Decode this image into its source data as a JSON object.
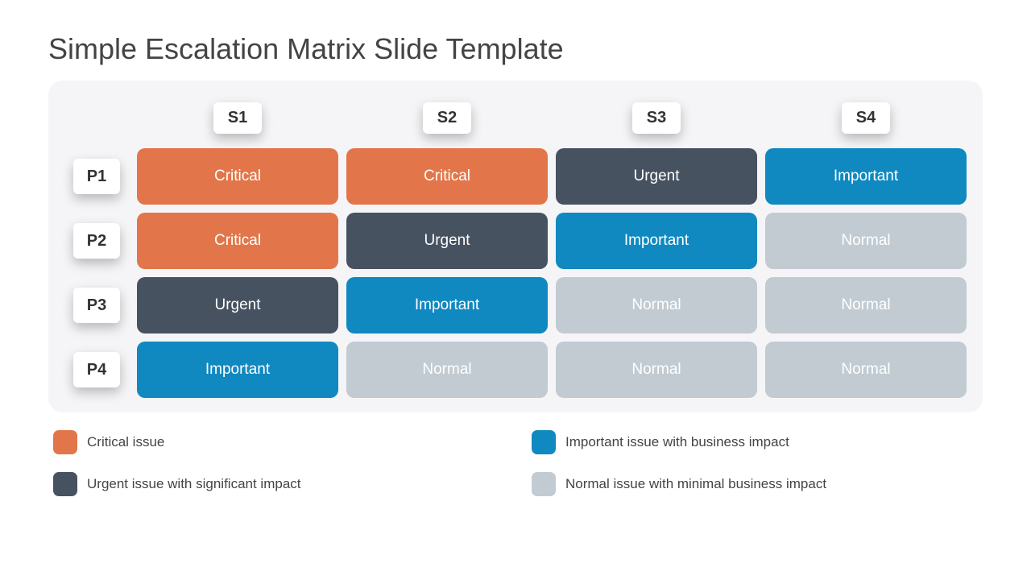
{
  "title": "Simple Escalation Matrix Slide Template",
  "columns": [
    "S1",
    "S2",
    "S3",
    "S4"
  ],
  "rows": [
    "P1",
    "P2",
    "P3",
    "P4"
  ],
  "cells": [
    [
      {
        "label": "Critical",
        "kind": "critical"
      },
      {
        "label": "Critical",
        "kind": "critical"
      },
      {
        "label": "Urgent",
        "kind": "urgent"
      },
      {
        "label": "Important",
        "kind": "important"
      }
    ],
    [
      {
        "label": "Critical",
        "kind": "critical"
      },
      {
        "label": "Urgent",
        "kind": "urgent"
      },
      {
        "label": "Important",
        "kind": "important"
      },
      {
        "label": "Normal",
        "kind": "normal"
      }
    ],
    [
      {
        "label": "Urgent",
        "kind": "urgent"
      },
      {
        "label": "Important",
        "kind": "important"
      },
      {
        "label": "Normal",
        "kind": "normal"
      },
      {
        "label": "Normal",
        "kind": "normal"
      }
    ],
    [
      {
        "label": "Important",
        "kind": "important"
      },
      {
        "label": "Normal",
        "kind": "normal"
      },
      {
        "label": "Normal",
        "kind": "normal"
      },
      {
        "label": "Normal",
        "kind": "normal"
      }
    ]
  ],
  "legend": [
    {
      "kind": "critical",
      "text": "Critical issue"
    },
    {
      "kind": "important",
      "text": "Important issue with business impact"
    },
    {
      "kind": "urgent",
      "text": "Urgent issue with significant impact"
    },
    {
      "kind": "normal",
      "text": "Normal issue with minimal business impact"
    }
  ],
  "colors": {
    "critical": "#e2764a",
    "urgent": "#475260",
    "important": "#1089c0",
    "normal": "#c2cbd2"
  }
}
